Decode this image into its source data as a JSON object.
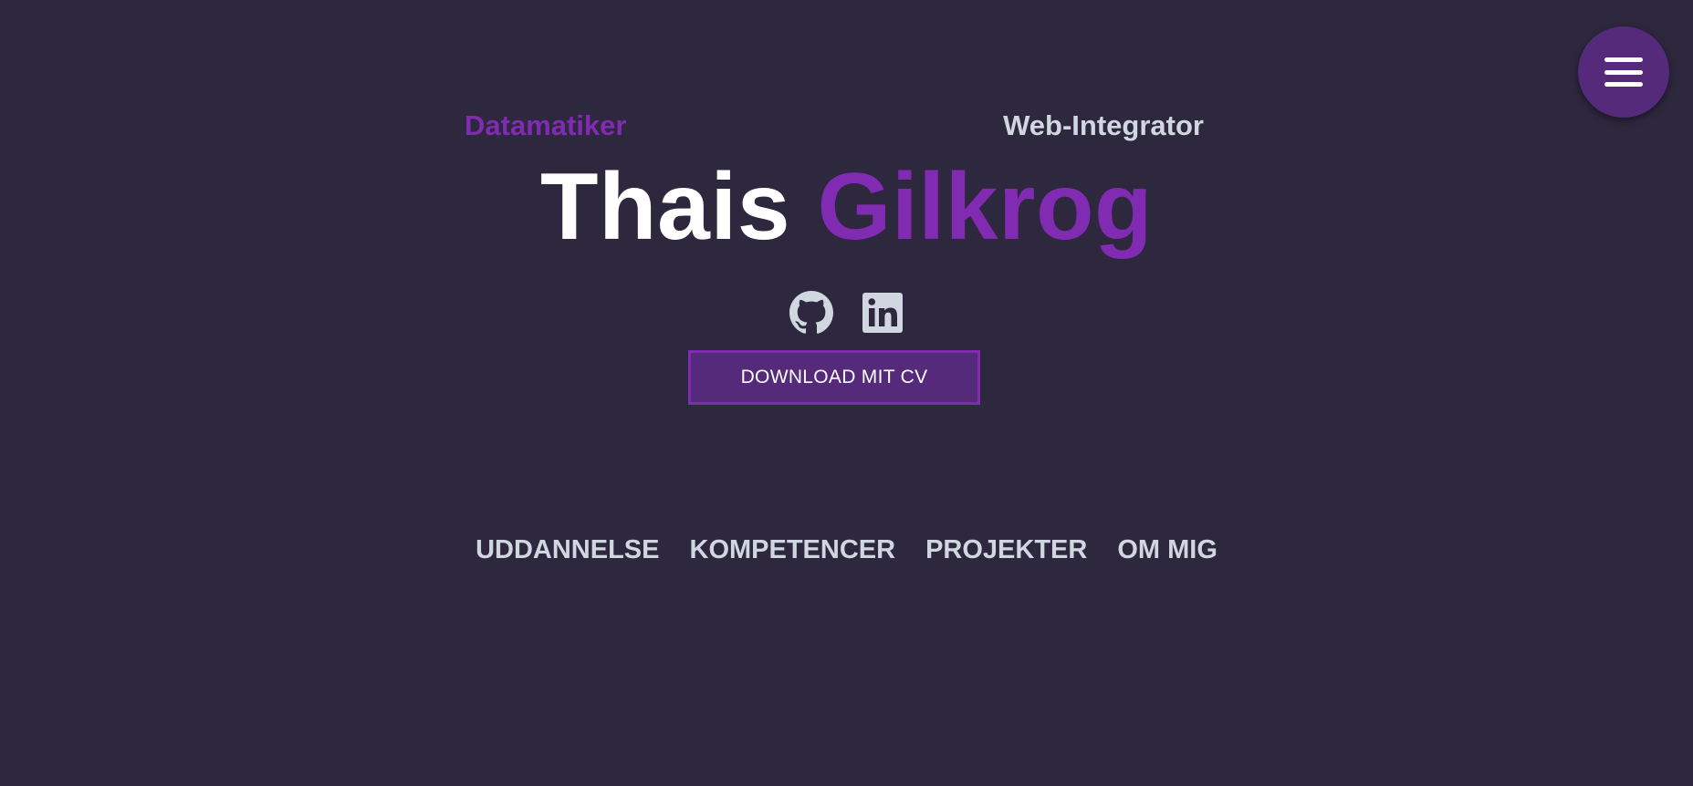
{
  "hero": {
    "subtitle_left": "Datamatiker",
    "subtitle_right": "Web-Integrator",
    "first_name": "Thais",
    "last_name": "Gilkrog"
  },
  "social": [
    {
      "icon": "github-icon"
    },
    {
      "icon": "linkedin-icon"
    }
  ],
  "cv_button": {
    "label": "DOWNLOAD MIT CV"
  },
  "nav": {
    "items": [
      {
        "label": "UDDANNELSE"
      },
      {
        "label": "KOMPETENCER"
      },
      {
        "label": "PROJEKTER"
      },
      {
        "label": "OM MIG"
      }
    ]
  },
  "menu": {
    "icon": "hamburger-icon"
  },
  "colors": {
    "background": "#2d283e",
    "accent": "#802bb1",
    "accent_dark": "#552a7a",
    "text_light": "#d1d7e0",
    "white": "#ffffff"
  }
}
